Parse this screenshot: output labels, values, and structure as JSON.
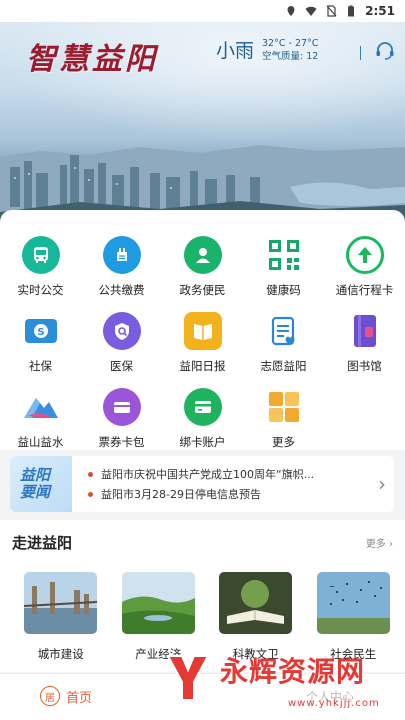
{
  "status_bar": {
    "time": "2:51",
    "icons": [
      "location-icon",
      "wifi-icon",
      "no-sim-icon",
      "battery-icon"
    ]
  },
  "hero": {
    "title": "智慧益阳",
    "weather": {
      "condition": "小雨",
      "temperature": "32°C - 27°C",
      "air_quality": "空气质量: 12"
    },
    "service_icon": "headset-icon"
  },
  "services": [
    {
      "label": "实时公交",
      "icon": "bus-icon",
      "color": "#17b89a"
    },
    {
      "label": "公共缴费",
      "icon": "payment-icon",
      "color": "#1f9be4"
    },
    {
      "label": "政务便民",
      "icon": "user-service-icon",
      "color": "#19b36b"
    },
    {
      "label": "健康码",
      "icon": "qr-code-icon",
      "color": "#16a86a"
    },
    {
      "label": "通信行程卡",
      "icon": "arrow-up-icon",
      "color": "#1bb75c"
    },
    {
      "label": "社保",
      "icon": "social-security-icon",
      "color": "#2b8fd8"
    },
    {
      "label": "医保",
      "icon": "medical-insurance-icon",
      "color": "#7a5ce0"
    },
    {
      "label": "益阳日报",
      "icon": "newspaper-icon",
      "color": "#f2b21b"
    },
    {
      "label": "志愿益阳",
      "icon": "volunteer-icon",
      "color": "#2a86d8"
    },
    {
      "label": "图书馆",
      "icon": "library-icon",
      "color": "#6b4fd0"
    },
    {
      "label": "益山益水",
      "icon": "mountain-icon",
      "color": "#3a8ee0"
    },
    {
      "label": "票券卡包",
      "icon": "ticket-wallet-icon",
      "color": "#9b55d8"
    },
    {
      "label": "绑卡账户",
      "icon": "bank-card-icon",
      "color": "#1fb35e"
    },
    {
      "label": "更多",
      "icon": "more-grid-icon",
      "color": "#f3a830"
    }
  ],
  "news": {
    "badge_line1": "益阳",
    "badge_line2": "要闻",
    "items": [
      "益阳市庆祝中国共产党成立100周年“旗帜...",
      "益阳市3月28-29日停电信息预告"
    ]
  },
  "explore": {
    "title": "走进益阳",
    "more": "更多",
    "items": [
      {
        "label": "城市建设",
        "icon": "city-photo"
      },
      {
        "label": "产业经济",
        "icon": "farmland-photo"
      },
      {
        "label": "科教文卫",
        "icon": "book-photo"
      },
      {
        "label": "社会民生",
        "icon": "birds-photo"
      }
    ]
  },
  "tabbar": {
    "home_label": "首页",
    "home_icon_char": "居",
    "center_label": "个人中心"
  },
  "watermark": {
    "text": "永辉资源网",
    "url": "www.yhkjjj.com"
  }
}
